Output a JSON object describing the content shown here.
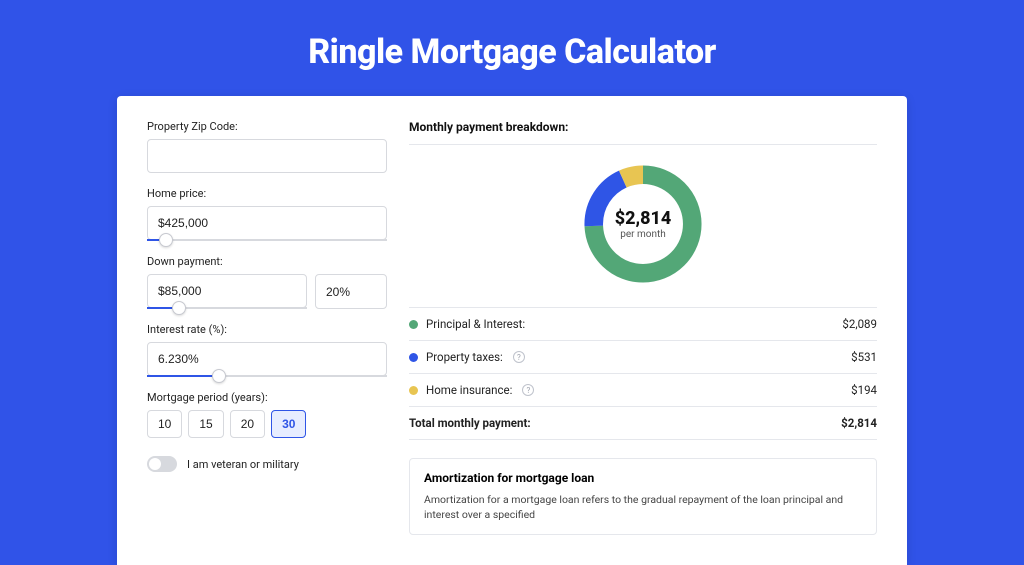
{
  "title": "Ringle Mortgage Calculator",
  "form": {
    "zip": {
      "label": "Property Zip Code:",
      "value": ""
    },
    "price": {
      "label": "Home price:",
      "value": "$425,000",
      "slider_pct": 8
    },
    "down": {
      "label": "Down payment:",
      "value": "$85,000",
      "pct_value": "20%",
      "slider_pct": 20
    },
    "rate": {
      "label": "Interest rate (%):",
      "value": "6.230%",
      "slider_pct": 30
    },
    "period": {
      "label": "Mortgage period (years):",
      "options": [
        "10",
        "15",
        "20",
        "30"
      ],
      "selected": "30"
    },
    "veteran": {
      "label": "I am veteran or military",
      "on": false
    }
  },
  "breakdown": {
    "title": "Monthly payment breakdown:",
    "center_amount": "$2,814",
    "center_caption": "per month",
    "rows": [
      {
        "key": "principal",
        "label": "Principal & Interest:",
        "value": "$2,089",
        "color": "green",
        "help": false
      },
      {
        "key": "taxes",
        "label": "Property taxes:",
        "value": "$531",
        "color": "blue",
        "help": true
      },
      {
        "key": "insurance",
        "label": "Home insurance:",
        "value": "$194",
        "color": "yellow",
        "help": true
      }
    ],
    "total_label": "Total monthly payment:",
    "total_value": "$2,814"
  },
  "chart_data": {
    "type": "pie",
    "title": "Monthly payment breakdown",
    "series": [
      {
        "name": "Principal & Interest",
        "value": 2089,
        "color": "#53a777"
      },
      {
        "name": "Property taxes",
        "value": 531,
        "color": "#2f55e6"
      },
      {
        "name": "Home insurance",
        "value": 194,
        "color": "#e8c552"
      }
    ],
    "total": 2814,
    "unit": "$ per month"
  },
  "amortization": {
    "title": "Amortization for mortgage loan",
    "text": "Amortization for a mortgage loan refers to the gradual repayment of the loan principal and interest over a specified"
  }
}
